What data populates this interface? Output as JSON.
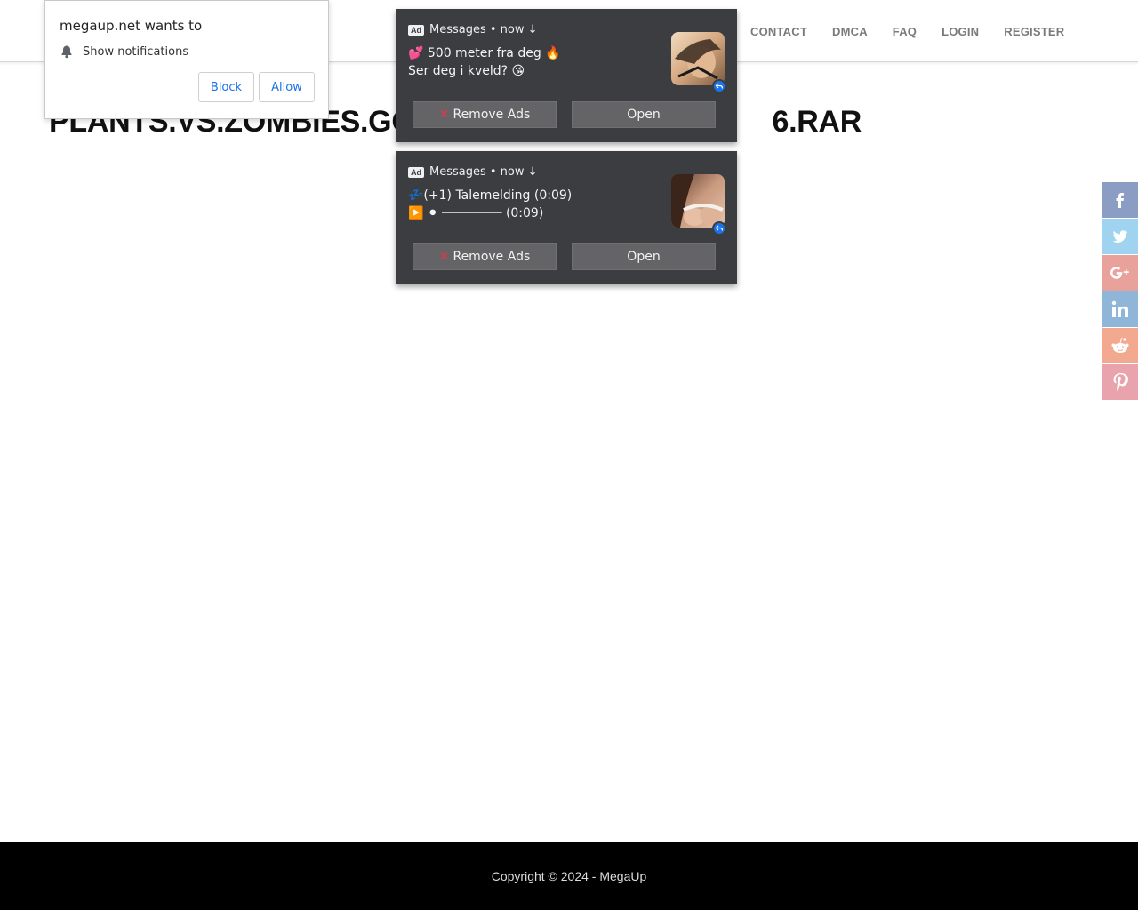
{
  "nav": {
    "links": [
      "CONTACT",
      "DMCA",
      "FAQ",
      "LOGIN",
      "REGISTER"
    ]
  },
  "page": {
    "title": "PLANTS.VS.ZOMBIES.GO",
    "title_suffix": "6.RAR"
  },
  "permission_prompt": {
    "title": "megaup.net wants to",
    "item": "Show notifications",
    "block_label": "Block",
    "allow_label": "Allow",
    "icon": "bell-icon"
  },
  "notifications": [
    {
      "badge": "Ad",
      "source": "Messages • now ↓",
      "line1": "💕 500 meter fra deg 🔥",
      "line2": "Ser deg i kveld? 😘",
      "remove_label": "Remove Ads",
      "open_label": "Open"
    },
    {
      "badge": "Ad",
      "source": "Messages • now ↓",
      "line1": "💤(+1) Talemelding (0:09)",
      "line2": "▶️ ⚫ ──────── (0:09)",
      "remove_label": "Remove Ads",
      "open_label": "Open"
    }
  ],
  "share": {
    "items": [
      {
        "icon": "facebook-icon",
        "color": "#8b9dc3"
      },
      {
        "icon": "twitter-icon",
        "color": "#9fd3f0"
      },
      {
        "icon": "google-plus-icon",
        "color": "#e9a19b"
      },
      {
        "icon": "linkedin-icon",
        "color": "#8fb6d9"
      },
      {
        "icon": "reddit-icon",
        "color": "#f3a98f"
      },
      {
        "icon": "pinterest-icon",
        "color": "#e8a3ac"
      }
    ]
  },
  "footer": {
    "copyright": "Copyright © 2024 - MegaUp"
  },
  "colors": {
    "notification_bg": "#3c3d41",
    "notification_button": "#646466",
    "accent_blue": "#1a73e8",
    "footer_bg": "#000000"
  }
}
